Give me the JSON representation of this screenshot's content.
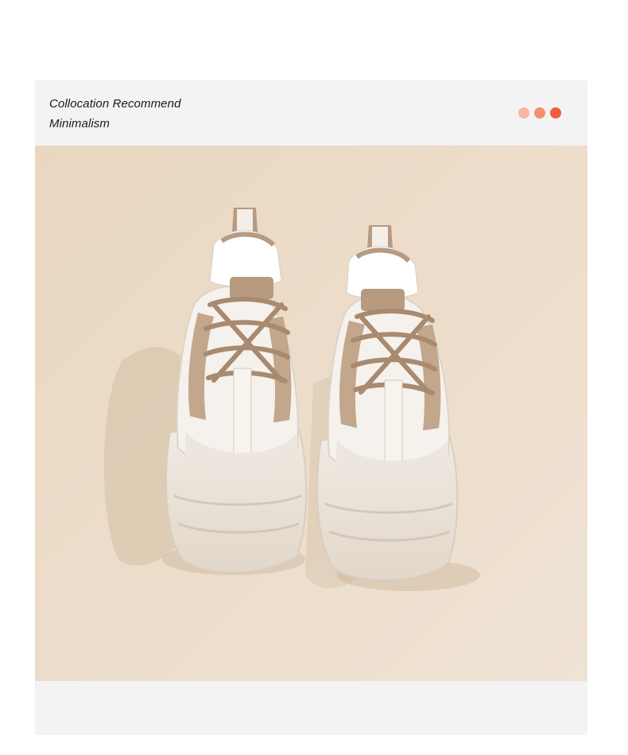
{
  "header": {
    "line1": "Collocation Recommend",
    "line2": "Minimalism"
  },
  "dots": [
    {
      "color": "#f9b6a3"
    },
    {
      "color": "#f58f6d"
    },
    {
      "color": "#ee5f3c"
    }
  ],
  "photo": {
    "subject": "pair of chunky white and khaki platform sneakers",
    "background_color": "#ebdcc8",
    "shoe_colors": {
      "upper": "#f4f0ea",
      "accent": "#b79a80",
      "sole": "#ece5dc"
    }
  }
}
